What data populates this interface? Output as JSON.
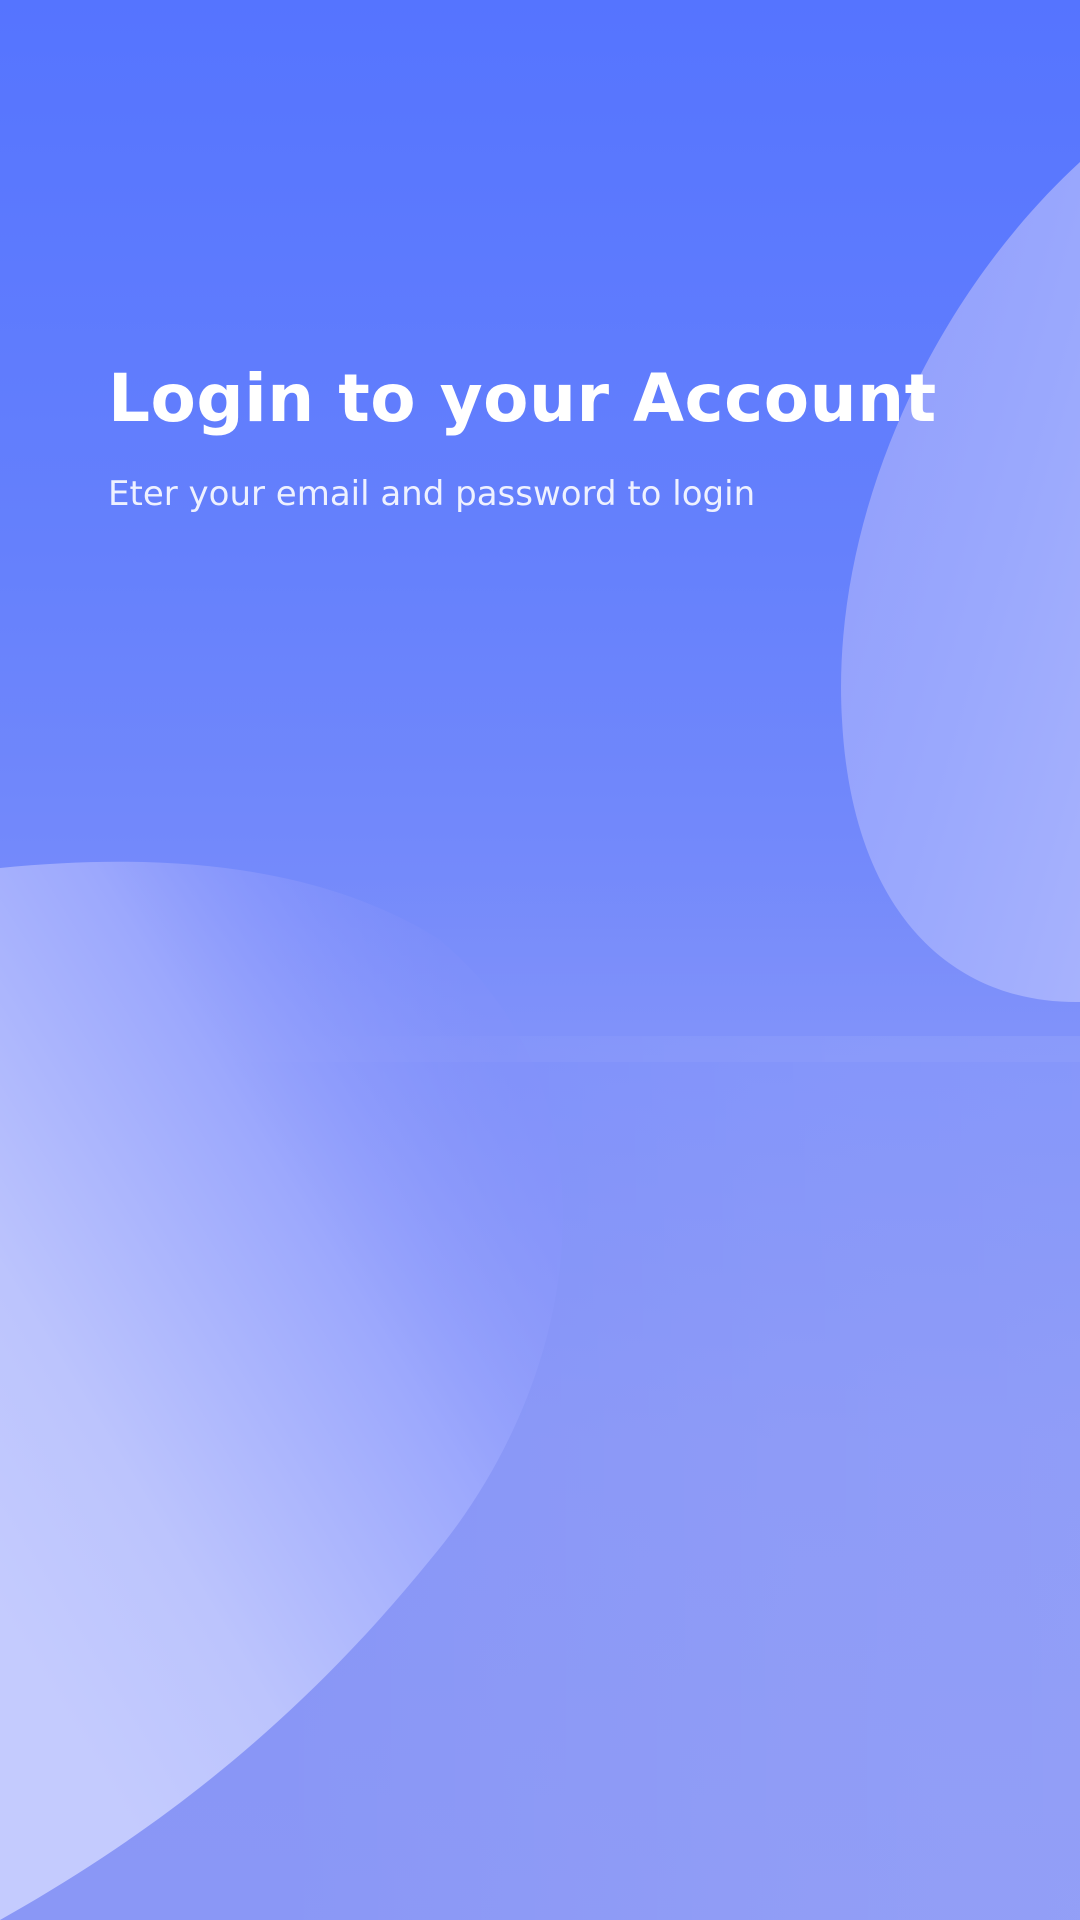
{
  "login": {
    "title": "Login to your Account",
    "subtitle": "Eter your email and password to login"
  },
  "colors": {
    "background_top": "#5574ff",
    "background_bottom": "#8a97f6",
    "blob_light": "#c2c9fd",
    "text_primary": "#ffffff"
  }
}
